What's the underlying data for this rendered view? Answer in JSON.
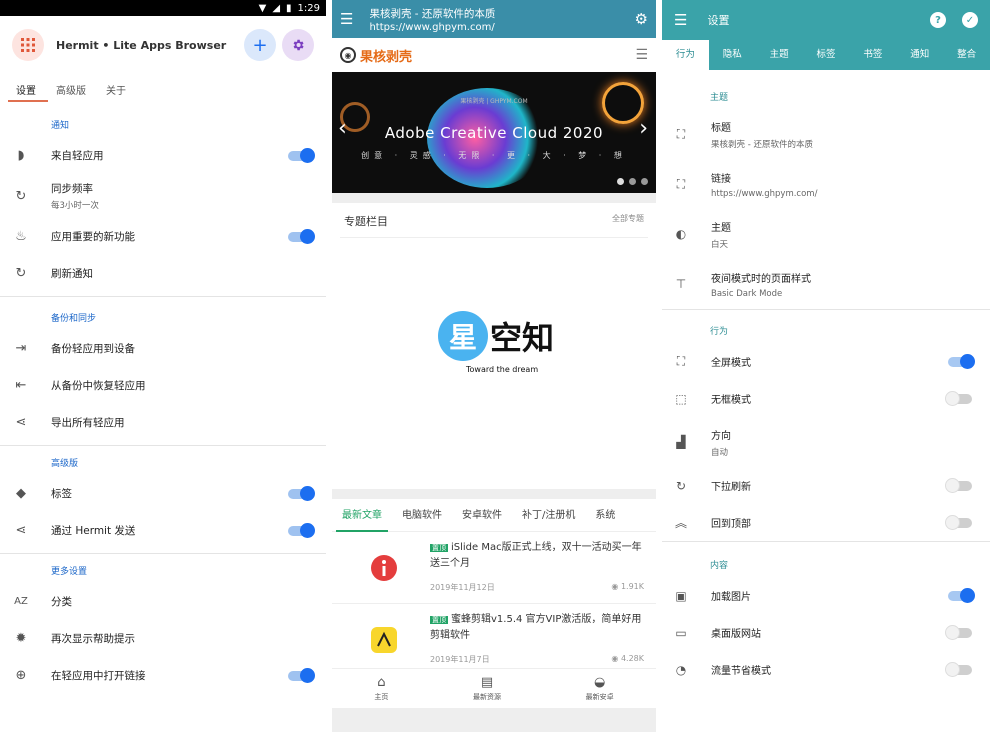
{
  "p1": {
    "status": {
      "time": "1:29"
    },
    "app_title": "Hermit • Lite Apps Browser",
    "tabs": [
      "设置",
      "高级版",
      "关于"
    ],
    "sections": {
      "notify": "通知",
      "backup": "备份和同步",
      "premium": "高级版",
      "more": "更多设置"
    },
    "rows": {
      "from_lite": "来自轻应用",
      "sync_freq": "同步频率",
      "sync_freq_sub": "每3小时一次",
      "important": "应用重要的新功能",
      "refresh_notify": "刷新通知",
      "backup_device": "备份轻应用到设备",
      "restore": "从备份中恢复轻应用",
      "export": "导出所有轻应用",
      "tags": "标签",
      "send_hermit": "通过 Hermit 发送",
      "category": "分类",
      "help_again": "再次显示帮助提示",
      "open_links": "在轻应用中打开链接"
    },
    "accent": "#1c6ef0"
  },
  "p2": {
    "top_title": "果核剥壳 - 还原软件的本质",
    "top_subtitle": "https://www.ghpym.com/",
    "logo_text": "果核剥壳",
    "banner": {
      "small": "果核剥壳 | GHPYM.COM",
      "big": "Adobe Creative Cloud 2020",
      "caption": "创意 · 灵感 · 无限 · 更 · 大 · 梦 · 想"
    },
    "special_title": "专题栏目",
    "special_all": "全部专题",
    "watermark": {
      "star": "星",
      "text": "空知",
      "sub": "Toward the dream"
    },
    "cat_tabs": [
      "最新文章",
      "电脑软件",
      "安卓软件",
      "补丁/注册机",
      "系统"
    ],
    "articles": [
      {
        "tag": "置顶",
        "title": "iSlide Mac版正式上线，双十一活动买一年送三个月",
        "date": "2019年11月12日",
        "views": "1.91K"
      },
      {
        "tag": "置顶",
        "title": "蜜蜂剪辑v1.5.4 官方VIP激活版，简单好用剪辑软件",
        "date": "2019年11月7日",
        "views": "4.28K"
      }
    ],
    "nav": [
      "主页",
      "最新资源",
      "最新安卓"
    ],
    "accent": "#21a366"
  },
  "p3": {
    "title": "设置",
    "tabs": [
      "行为",
      "隐私",
      "主题",
      "标签",
      "书签",
      "通知",
      "整合"
    ],
    "sections": {
      "theme": "主题",
      "behavior": "行为",
      "content": "内容"
    },
    "rows": {
      "title_lbl": "标题",
      "title_val": "果核剥壳 - 还原软件的本质",
      "link_lbl": "链接",
      "link_val": "https://www.ghpym.com/",
      "theme_lbl": "主题",
      "theme_val": "白天",
      "night_lbl": "夜间模式时的页面样式",
      "night_val": "Basic Dark Mode",
      "fullscreen": "全屏模式",
      "frameless": "无框模式",
      "orientation": "方向",
      "orientation_val": "自动",
      "pull_refresh": "下拉刷新",
      "back_top": "回到顶部",
      "load_images": "加载图片",
      "desktop_site": "桌面版网站",
      "data_saver": "流量节省模式"
    },
    "accent": "#3aa3a9"
  }
}
